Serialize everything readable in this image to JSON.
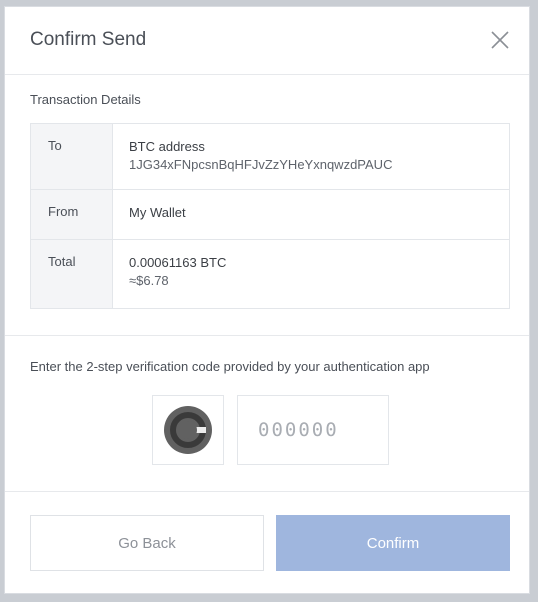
{
  "dialog": {
    "title": "Confirm Send",
    "close_icon": "close-icon"
  },
  "details": {
    "section_label": "Transaction Details",
    "rows": [
      {
        "label": "To",
        "line1": "BTC address",
        "line2": "1JG34xFNpcsnBqHFJvZzYHeYxnqwzdPAUC"
      },
      {
        "label": "From",
        "line1": "My Wallet",
        "line2": ""
      },
      {
        "label": "Total",
        "line1": "0.00061163 BTC",
        "line2": "≈$6.78"
      }
    ]
  },
  "verification": {
    "prompt": "Enter the 2-step verification code provided by your authentication app",
    "code_placeholder": "000000",
    "code_value": "",
    "app_icon": "google-authenticator-icon"
  },
  "actions": {
    "back_label": "Go Back",
    "confirm_label": "Confirm"
  },
  "colors": {
    "confirm_button": "#9fb6de",
    "label_cell_bg": "#f4f5f7",
    "border": "#e3e6ea"
  }
}
